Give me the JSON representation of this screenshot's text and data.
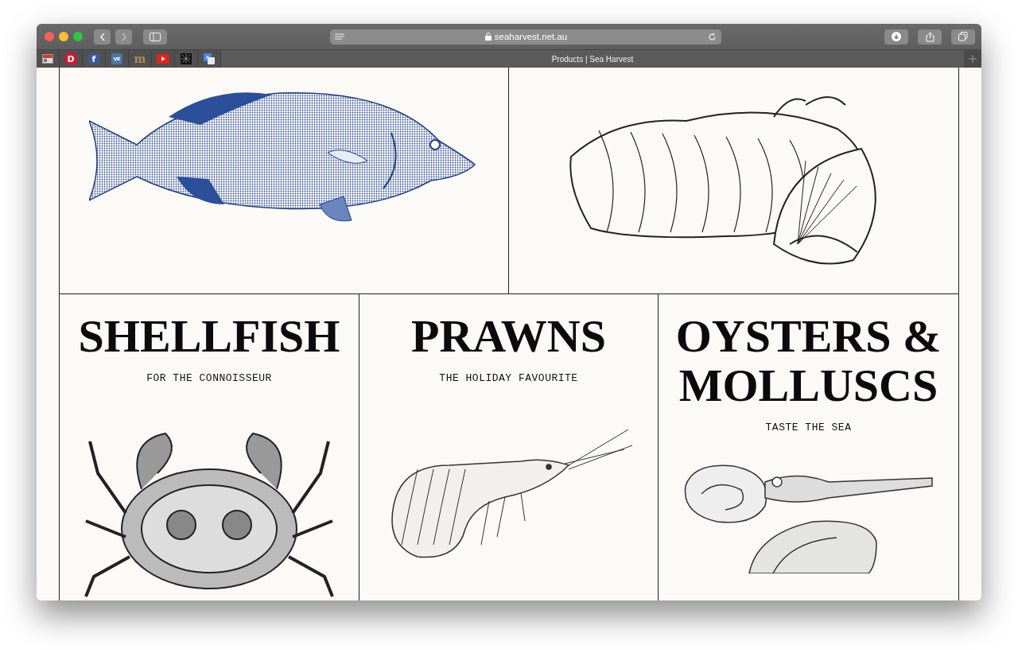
{
  "browser": {
    "address": "seaharvest.net.au",
    "secure": true,
    "tab_title": "Products | Sea Harvest",
    "pinned_tabs": [
      {
        "kind": "reader",
        "color": "#d33a2c"
      },
      {
        "kind": "letter",
        "glyph": "D",
        "color": "#e0102a"
      },
      {
        "kind": "letter",
        "glyph": "f",
        "color": "#3b5998"
      },
      {
        "kind": "vk",
        "color": "#4a76a8"
      },
      {
        "kind": "serif",
        "glyph": "m",
        "color": "#b08a55"
      },
      {
        "kind": "play",
        "color": "#e62117"
      },
      {
        "kind": "pattern",
        "color": "#111111"
      },
      {
        "kind": "translate",
        "color": "#4285f4"
      }
    ]
  },
  "top_row": [
    {
      "kind": "fish"
    },
    {
      "kind": "salmon"
    }
  ],
  "products": [
    {
      "title": "SHELLFISH",
      "subtitle": "FOR THE CONNOISSEUR",
      "kind": "crab"
    },
    {
      "title": "PRAWNS",
      "subtitle": "THE HOLIDAY FAVOURITE",
      "kind": "prawn"
    },
    {
      "title": "OYSTERS & MOLLUSCS",
      "subtitle": "TASTE THE SEA",
      "kind": "mollusc"
    }
  ]
}
